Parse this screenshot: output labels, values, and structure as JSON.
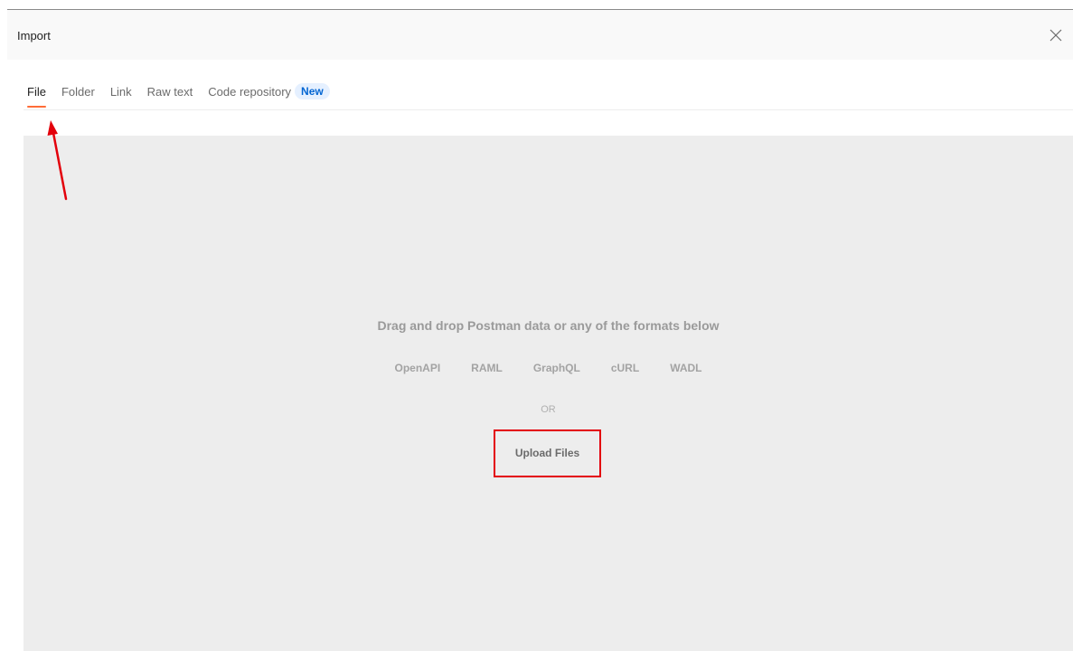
{
  "modal": {
    "title": "Import",
    "close_icon": "close-icon"
  },
  "tabs": [
    {
      "label": "File",
      "active": true
    },
    {
      "label": "Folder",
      "active": false
    },
    {
      "label": "Link",
      "active": false
    },
    {
      "label": "Raw text",
      "active": false
    },
    {
      "label": "Code repository",
      "badge": "New",
      "active": false
    }
  ],
  "dropzone": {
    "title": "Drag and drop Postman data or any of the formats below",
    "formats": [
      "OpenAPI",
      "RAML",
      "GraphQL",
      "cURL",
      "WADL"
    ],
    "or_text": "OR",
    "upload_label": "Upload Files"
  },
  "colors": {
    "accent": "#ff6c37",
    "badge_text": "#0265d2",
    "badge_bg": "#e5f0ff",
    "annotation": "#e3000b",
    "dropzone_bg": "#ededed"
  }
}
